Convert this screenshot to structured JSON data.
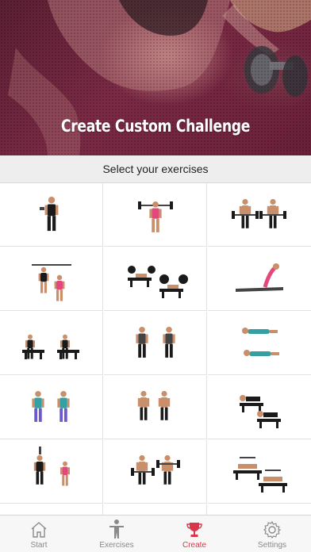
{
  "hero": {
    "title": "Create Custom Challenge"
  },
  "section": {
    "label": "Select your exercises"
  },
  "colors": {
    "accent": "#d9364c",
    "hero_tint": "#6a2039",
    "tab_inactive": "#888888"
  },
  "exercises": [
    {
      "icon": "dumbbell-curl-icon"
    },
    {
      "icon": "barbell-overhead-press-icon"
    },
    {
      "icon": "barbell-curl-pair-icon"
    },
    {
      "icon": "pull-up-pair-icon"
    },
    {
      "icon": "bench-press-pair-icon"
    },
    {
      "icon": "cobra-stretch-icon"
    },
    {
      "icon": "bench-dip-pair-icon"
    },
    {
      "icon": "dumbbell-shrug-pair-icon"
    },
    {
      "icon": "push-up-pair-icon"
    },
    {
      "icon": "lateral-raise-pair-icon"
    },
    {
      "icon": "dumbbell-row-pair-icon"
    },
    {
      "icon": "incline-fly-pair-icon"
    },
    {
      "icon": "overhead-press-pair-icon"
    },
    {
      "icon": "barbell-upright-row-pair-icon"
    },
    {
      "icon": "decline-bench-pair-icon"
    }
  ],
  "tabs": [
    {
      "label": "Start",
      "icon": "house-icon",
      "active": false
    },
    {
      "label": "Exercises",
      "icon": "person-icon",
      "active": false
    },
    {
      "label": "Create",
      "icon": "trophy-icon",
      "active": true
    },
    {
      "label": "Settings",
      "icon": "gear-icon",
      "active": false
    }
  ]
}
